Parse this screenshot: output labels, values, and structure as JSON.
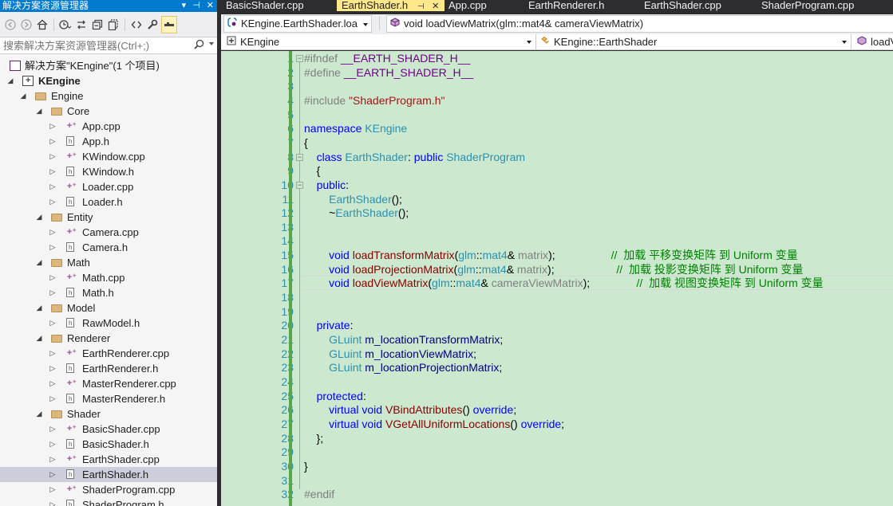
{
  "solution_explorer": {
    "title": "解决方案资源管理器",
    "title_buttons": [
      "▾",
      "⊣",
      "✕"
    ],
    "search_placeholder": "搜索解决方案资源管理器(Ctrl+;)",
    "tree": [
      {
        "label": "解决方案\"KEngine\"(1 个项目)",
        "level": 0,
        "kind": "solution",
        "arrow": ""
      },
      {
        "label": "KEngine",
        "level": 0,
        "kind": "project",
        "arrow": "◢",
        "bold": true
      },
      {
        "label": "Engine",
        "level": 1,
        "kind": "folder",
        "arrow": "◢"
      },
      {
        "label": "Core",
        "level": 2,
        "kind": "folder",
        "arrow": "◢"
      },
      {
        "label": "App.cpp",
        "level": 3,
        "kind": "cpp",
        "arrow": "▷"
      },
      {
        "label": "App.h",
        "level": 3,
        "kind": "h",
        "arrow": "▷"
      },
      {
        "label": "KWindow.cpp",
        "level": 3,
        "kind": "cpp",
        "arrow": "▷"
      },
      {
        "label": "KWindow.h",
        "level": 3,
        "kind": "h",
        "arrow": "▷"
      },
      {
        "label": "Loader.cpp",
        "level": 3,
        "kind": "cpp",
        "arrow": "▷"
      },
      {
        "label": "Loader.h",
        "level": 3,
        "kind": "h",
        "arrow": "▷"
      },
      {
        "label": "Entity",
        "level": 2,
        "kind": "folder",
        "arrow": "◢"
      },
      {
        "label": "Camera.cpp",
        "level": 3,
        "kind": "cpp",
        "arrow": "▷"
      },
      {
        "label": "Camera.h",
        "level": 3,
        "kind": "h",
        "arrow": "▷"
      },
      {
        "label": "Math",
        "level": 2,
        "kind": "folder",
        "arrow": "◢"
      },
      {
        "label": "Math.cpp",
        "level": 3,
        "kind": "cpp",
        "arrow": "▷"
      },
      {
        "label": "Math.h",
        "level": 3,
        "kind": "h",
        "arrow": "▷"
      },
      {
        "label": "Model",
        "level": 2,
        "kind": "folder",
        "arrow": "◢"
      },
      {
        "label": "RawModel.h",
        "level": 3,
        "kind": "h",
        "arrow": "▷"
      },
      {
        "label": "Renderer",
        "level": 2,
        "kind": "folder",
        "arrow": "◢"
      },
      {
        "label": "EarthRenderer.cpp",
        "level": 3,
        "kind": "cpp",
        "arrow": "▷"
      },
      {
        "label": "EarthRenderer.h",
        "level": 3,
        "kind": "h",
        "arrow": "▷"
      },
      {
        "label": "MasterRenderer.cpp",
        "level": 3,
        "kind": "cpp",
        "arrow": "▷"
      },
      {
        "label": "MasterRenderer.h",
        "level": 3,
        "kind": "h",
        "arrow": "▷"
      },
      {
        "label": "Shader",
        "level": 2,
        "kind": "folder",
        "arrow": "◢"
      },
      {
        "label": "BasicShader.cpp",
        "level": 3,
        "kind": "cpp",
        "arrow": "▷"
      },
      {
        "label": "BasicShader.h",
        "level": 3,
        "kind": "h",
        "arrow": "▷"
      },
      {
        "label": "EarthShader.cpp",
        "level": 3,
        "kind": "cpp",
        "arrow": "▷"
      },
      {
        "label": "EarthShader.h",
        "level": 3,
        "kind": "h",
        "arrow": "▷",
        "selected": true
      },
      {
        "label": "ShaderProgram.cpp",
        "level": 3,
        "kind": "cpp",
        "arrow": "▷"
      },
      {
        "label": "ShaderProgram.h",
        "level": 3,
        "kind": "h",
        "arrow": "▷"
      }
    ]
  },
  "tabs": [
    {
      "label": "BasicShader.cpp",
      "active": false
    },
    {
      "label": "EarthShader.h",
      "active": true,
      "pin": "⊣",
      "close": "✕"
    },
    {
      "label": "App.cpp",
      "active": false
    },
    {
      "label": "EarthRenderer.h",
      "active": false
    },
    {
      "label": "EarthShader.cpp",
      "active": false
    },
    {
      "label": "ShaderProgram.cpp",
      "active": false
    }
  ],
  "nav": {
    "file_combo": "KEngine.EarthShader.loa",
    "member_combo": "void loadViewMatrix(glm::mat4& cameraViewMatrix)",
    "project_combo": "KEngine",
    "scope_combo": "KEngine::EarthShader",
    "function_combo": "loadV"
  },
  "code_lines": [
    {
      "n": "1",
      "t": [
        [
          "pp",
          "#ifndef "
        ],
        [
          "mac",
          "__EARTH_SHADER_H__"
        ]
      ]
    },
    {
      "n": "2",
      "t": [
        [
          "pp",
          "#define "
        ],
        [
          "mac",
          "__EARTH_SHADER_H__"
        ]
      ]
    },
    {
      "n": "3",
      "t": []
    },
    {
      "n": "4",
      "t": [
        [
          "pp",
          "#include "
        ],
        [
          "str",
          "\"ShaderProgram.h\""
        ]
      ]
    },
    {
      "n": "5",
      "t": []
    },
    {
      "n": "6",
      "t": [
        [
          "kw",
          "namespace "
        ],
        [
          "ty",
          "KEngine"
        ]
      ]
    },
    {
      "n": "7",
      "t": [
        [
          "op",
          "{"
        ]
      ]
    },
    {
      "n": "8",
      "t": [
        [
          "op",
          "    "
        ],
        [
          "kw",
          "class "
        ],
        [
          "ty",
          "EarthShader"
        ],
        [
          "op",
          ": "
        ],
        [
          "kw",
          "public "
        ],
        [
          "ty",
          "ShaderProgram"
        ]
      ]
    },
    {
      "n": "9",
      "t": [
        [
          "op",
          "    {"
        ]
      ]
    },
    {
      "n": "10",
      "t": [
        [
          "op",
          "    "
        ],
        [
          "kw",
          "public"
        ],
        [
          "op",
          ":"
        ]
      ]
    },
    {
      "n": "11",
      "t": [
        [
          "op",
          "        "
        ],
        [
          "ty",
          "EarthShader"
        ],
        [
          "op",
          "();"
        ]
      ]
    },
    {
      "n": "12",
      "t": [
        [
          "op",
          "        ~"
        ],
        [
          "ty",
          "EarthShader"
        ],
        [
          "op",
          "();"
        ]
      ]
    },
    {
      "n": "13",
      "t": []
    },
    {
      "n": "14",
      "t": []
    },
    {
      "n": "15",
      "t": [
        [
          "op",
          "        "
        ],
        [
          "kw",
          "void "
        ],
        [
          "fn",
          "loadTransformMatrix"
        ],
        [
          "op",
          "("
        ],
        [
          "ty",
          "glm"
        ],
        [
          "op",
          "::"
        ],
        [
          "ty",
          "mat4"
        ],
        [
          "op",
          "& "
        ],
        [
          "par",
          "matrix"
        ],
        [
          "op",
          ");                  "
        ],
        [
          "cm",
          "//  加载 平移变换矩阵 到 Uniform 变量"
        ]
      ]
    },
    {
      "n": "16",
      "t": [
        [
          "op",
          "        "
        ],
        [
          "kw",
          "void "
        ],
        [
          "fn",
          "loadProjectionMatrix"
        ],
        [
          "op",
          "("
        ],
        [
          "ty",
          "glm"
        ],
        [
          "op",
          "::"
        ],
        [
          "ty",
          "mat4"
        ],
        [
          "op",
          "& "
        ],
        [
          "par",
          "matrix"
        ],
        [
          "op",
          ");                    "
        ],
        [
          "cm",
          "//  加载 投影变换矩阵 到 Uniform 变量"
        ]
      ]
    },
    {
      "n": "17",
      "t": [
        [
          "op",
          "        "
        ],
        [
          "kw",
          "void "
        ],
        [
          "fn",
          "loadViewMatrix"
        ],
        [
          "op",
          "("
        ],
        [
          "ty",
          "glm"
        ],
        [
          "op",
          "::"
        ],
        [
          "ty",
          "mat4"
        ],
        [
          "op",
          "& "
        ],
        [
          "par",
          "cameraViewMatrix"
        ],
        [
          "op",
          ");               "
        ],
        [
          "cm",
          "//  加载 视图变换矩阵 到 Uniform 变量"
        ]
      ]
    },
    {
      "n": "18",
      "t": []
    },
    {
      "n": "19",
      "t": []
    },
    {
      "n": "20",
      "t": [
        [
          "op",
          "    "
        ],
        [
          "kw",
          "private"
        ],
        [
          "op",
          ":"
        ]
      ]
    },
    {
      "n": "21",
      "t": [
        [
          "op",
          "        "
        ],
        [
          "ty",
          "GLuint "
        ],
        [
          "mem",
          "m_locationTransformMatrix"
        ],
        [
          "op",
          ";"
        ]
      ]
    },
    {
      "n": "22",
      "t": [
        [
          "op",
          "        "
        ],
        [
          "ty",
          "GLuint "
        ],
        [
          "mem",
          "m_locationViewMatrix"
        ],
        [
          "op",
          ";"
        ]
      ]
    },
    {
      "n": "23",
      "t": [
        [
          "op",
          "        "
        ],
        [
          "ty",
          "GLuint "
        ],
        [
          "mem",
          "m_locationProjectionMatrix"
        ],
        [
          "op",
          ";"
        ]
      ]
    },
    {
      "n": "24",
      "t": []
    },
    {
      "n": "25",
      "t": [
        [
          "op",
          "    "
        ],
        [
          "kw",
          "protected"
        ],
        [
          "op",
          ":"
        ]
      ]
    },
    {
      "n": "26",
      "t": [
        [
          "op",
          "        "
        ],
        [
          "kw",
          "virtual void "
        ],
        [
          "fn",
          "VBindAttributes"
        ],
        [
          "op",
          "() "
        ],
        [
          "kw",
          "override"
        ],
        [
          "op",
          ";"
        ]
      ]
    },
    {
      "n": "27",
      "t": [
        [
          "op",
          "        "
        ],
        [
          "kw",
          "virtual void "
        ],
        [
          "fn",
          "VGetAllUniformLocations"
        ],
        [
          "op",
          "() "
        ],
        [
          "kw",
          "override"
        ],
        [
          "op",
          ";"
        ]
      ]
    },
    {
      "n": "28",
      "t": [
        [
          "op",
          "    };"
        ]
      ]
    },
    {
      "n": "29",
      "t": []
    },
    {
      "n": "30",
      "t": [
        [
          "op",
          "}"
        ]
      ]
    },
    {
      "n": "31",
      "t": []
    },
    {
      "n": "32",
      "t": [
        [
          "pp",
          "#endif"
        ]
      ]
    }
  ],
  "colors": {
    "title_bar": "#007acc",
    "active_tab": "#ffe88c",
    "editor_background": "#cce8cf",
    "selected_item": "#cccedb",
    "keyword": "#0000ff",
    "type": "#2b91af",
    "function": "#880000",
    "comment": "#008000",
    "string": "#a31515",
    "macro": "#6f008a"
  }
}
